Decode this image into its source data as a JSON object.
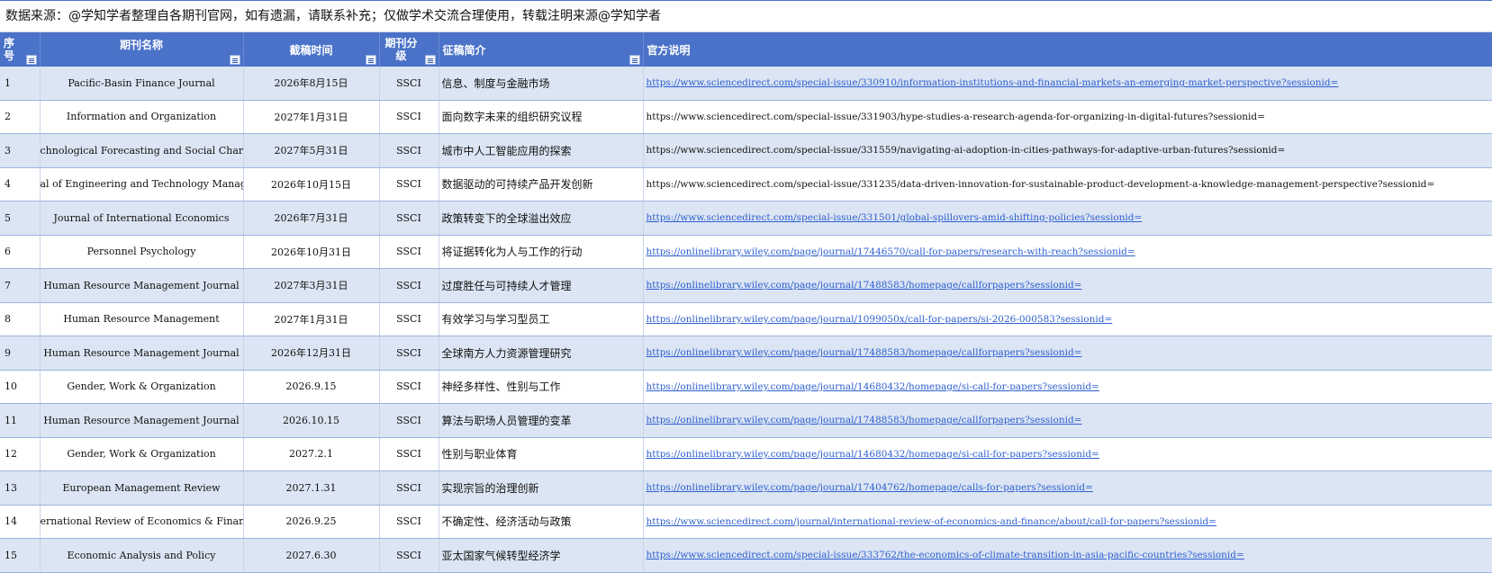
{
  "notice": "数据来源：@学知学者整理自各期刊官网，如有遗漏，请联系补充；仅做学术交流合理使用，转载注明来源@学知学者",
  "headers": {
    "seq": "序号",
    "journal": "期刊名称",
    "deadline": "截稿时间",
    "level": "期刊分级",
    "topic": "征稿简介",
    "official": "官方说明"
  },
  "rows": [
    {
      "seq": "1",
      "journal": "Pacific-Basin Finance Journal",
      "deadline": "2026年8月15日",
      "level": "SSCI",
      "topic": "信息、制度与金融市场",
      "url": "https://www.sciencedirect.com/special-issue/330910/information-institutions-and-financial-markets-an-emerging-market-perspective?sessionid=",
      "link": true
    },
    {
      "seq": "2",
      "journal": "Information and Organization",
      "deadline": "2027年1月31日",
      "level": "SSCI",
      "topic": "面向数字未来的组织研究议程",
      "url": "https://www.sciencedirect.com/special-issue/331903/hype-studies-a-research-agenda-for-organizing-in-digital-futures?sessionid=",
      "link": false
    },
    {
      "seq": "3",
      "journal": "chnological Forecasting and Social Char",
      "deadline": "2027年5月31日",
      "level": "SSCI",
      "topic": "城市中人工智能应用的探索",
      "url": "https://www.sciencedirect.com/special-issue/331559/navigating-ai-adoption-in-cities-pathways-for-adaptive-urban-futures?sessionid=",
      "link": false
    },
    {
      "seq": "4",
      "journal": "al of Engineering and Technology Manag",
      "deadline": "2026年10月15日",
      "level": "SSCI",
      "topic": "数据驱动的可持续产品开发创新",
      "url": "https://www.sciencedirect.com/special-issue/331235/data-driven-innovation-for-sustainable-product-development-a-knowledge-management-perspective?sessionid=",
      "link": false
    },
    {
      "seq": "5",
      "journal": "Journal of International Economics",
      "deadline": "2026年7月31日",
      "level": "SSCI",
      "topic": "政策转变下的全球溢出效应",
      "url": "https://www.sciencedirect.com/special-issue/331501/global-spillovers-amid-shifting-policies?sessionid=",
      "link": true
    },
    {
      "seq": "6",
      "journal": "Personnel Psychology",
      "deadline": "2026年10月31日",
      "level": "SSCI",
      "topic": "将证据转化为人与工作的行动",
      "url": "https://onlinelibrary.wiley.com/page/journal/17446570/call-for-papers/research-with-reach?sessionid=",
      "link": true
    },
    {
      "seq": "7",
      "journal": "Human Resource Management Journal",
      "deadline": "2027年3月31日",
      "level": "SSCI",
      "topic": "过度胜任与可持续人才管理",
      "url": "https://onlinelibrary.wiley.com/page/journal/17488583/homepage/callforpapers?sessionid=",
      "link": true
    },
    {
      "seq": "8",
      "journal": "Human Resource Management",
      "deadline": "2027年1月31日",
      "level": "SSCI",
      "topic": "有效学习与学习型员工",
      "url": "https://onlinelibrary.wiley.com/page/journal/1099050x/call-for-papers/si-2026-000583?sessionid=",
      "link": true
    },
    {
      "seq": "9",
      "journal": "Human Resource Management Journal",
      "deadline": "2026年12月31日",
      "level": "SSCI",
      "topic": "全球南方人力资源管理研究",
      "url": "https://onlinelibrary.wiley.com/page/journal/17488583/homepage/callforpapers?sessionid=",
      "link": true
    },
    {
      "seq": "10",
      "journal": "Gender, Work & Organization",
      "deadline": "2026.9.15",
      "level": "SSCI",
      "topic": "神经多样性、性别与工作",
      "url": "https://onlinelibrary.wiley.com/page/journal/14680432/homepage/si-call-for-papers?sessionid=",
      "link": true
    },
    {
      "seq": "11",
      "journal": "Human Resource Management Journal",
      "deadline": "2026.10.15",
      "level": "SSCI",
      "topic": "算法与职场人员管理的变革",
      "url": "https://onlinelibrary.wiley.com/page/journal/17488583/homepage/callforpapers?sessionid=",
      "link": true
    },
    {
      "seq": "12",
      "journal": "Gender, Work & Organization",
      "deadline": "2027.2.1",
      "level": "SSCI",
      "topic": "性别与职业体育",
      "url": "https://onlinelibrary.wiley.com/page/journal/14680432/homepage/si-call-for-papers?sessionid=",
      "link": true
    },
    {
      "seq": "13",
      "journal": "European Management Review",
      "deadline": "2027.1.31",
      "level": "SSCI",
      "topic": "实现宗旨的治理创新",
      "url": "https://onlinelibrary.wiley.com/page/journal/17404762/homepage/calls-for-papers?sessionid=",
      "link": true
    },
    {
      "seq": "14",
      "journal": "ernational Review of Economics & Finan",
      "deadline": "2026.9.25",
      "level": "SSCI",
      "topic": "不确定性、经济活动与政策",
      "url": "https://www.sciencedirect.com/journal/international-review-of-economics-and-finance/about/call-for-papers?sessionid=",
      "link": true
    },
    {
      "seq": "15",
      "journal": "Economic Analysis and Policy",
      "deadline": "2027.6.30",
      "level": "SSCI",
      "topic": "亚太国家气候转型经济学",
      "url": "https://www.sciencedirect.com/special-issue/333762/the-economics-of-climate-transition-in-asia-pacific-countries?sessionid=",
      "link": true
    }
  ],
  "colors": {
    "header_bg": "#4a72c8",
    "row_stripe": "#dce5f3",
    "link": "#2d5fd0"
  }
}
